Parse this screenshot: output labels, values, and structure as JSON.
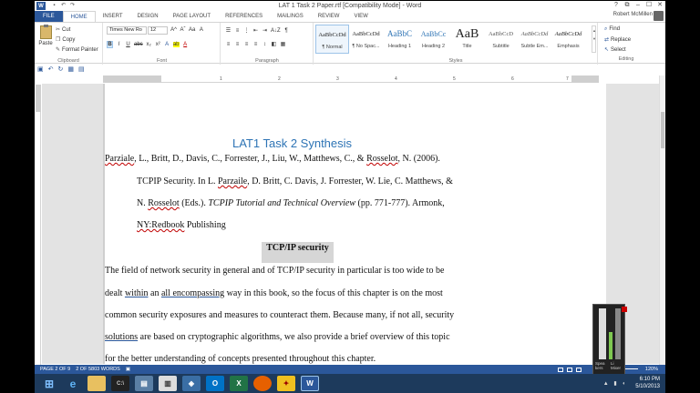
{
  "window": {
    "title": "LAT 1 Task 2 Paper.rtf [Compatibility Mode] - Word",
    "app_icon": "W",
    "controls": [
      "?",
      "⧉",
      "–",
      "☐",
      "✕"
    ]
  },
  "tabs": [
    "FILE",
    "HOME",
    "INSERT",
    "DESIGN",
    "PAGE LAYOUT",
    "REFERENCES",
    "MAILINGS",
    "REVIEW",
    "VIEW"
  ],
  "active_tab": "HOME",
  "user": {
    "name": "Robert McMillen"
  },
  "ribbon": {
    "clipboard": {
      "label": "Clipboard",
      "paste": "Paste",
      "cut": "Cut",
      "copy": "Copy",
      "format_painter": "Format Painter"
    },
    "font": {
      "label": "Font",
      "font_name": "Times New Ro",
      "font_size": "12",
      "grow": "A^",
      "shrink": "Aˇ",
      "case": "Aa",
      "clear": "A",
      "bold": "B",
      "italic": "I",
      "underline": "U",
      "strike": "abc",
      "sub": "x₂",
      "sup": "x²",
      "effects": "A",
      "highlight": "ab",
      "color": "A"
    },
    "paragraph": {
      "label": "Paragraph",
      "pilcrow": "¶",
      "sort": "A↓Z"
    },
    "styles": {
      "label": "Styles",
      "items": [
        {
          "sample": "AaBbCcDd",
          "name": "¶ Normal"
        },
        {
          "sample": "AaBbCcDd",
          "name": "¶ No Spac..."
        },
        {
          "sample": "AaBbC",
          "name": "Heading 1"
        },
        {
          "sample": "AaBbCc",
          "name": "Heading 2"
        },
        {
          "sample": "AaB",
          "name": "Title"
        },
        {
          "sample": "AaBbCcD",
          "name": "Subtitle"
        },
        {
          "sample": "AaBbCcDd",
          "name": "Subtle Em..."
        },
        {
          "sample": "AaBbCcDd",
          "name": "Emphasis"
        }
      ]
    },
    "editing": {
      "label": "Editing",
      "find": "Find",
      "replace": "Replace",
      "select": "Select"
    }
  },
  "ruler": {
    "ticks": [
      "1",
      "2",
      "3",
      "4",
      "5",
      "6",
      "7"
    ]
  },
  "document": {
    "heading": "LAT1 Task 2 Synthesis",
    "ref_line1_a": "Parziale",
    "ref_line1_b": ", L., Britt, D., Davis, C., Forrester, J., Liu, W., Matthews, C., & ",
    "ref_line1_c": "Rosselot",
    "ref_line1_d": ", N. (2006).",
    "ref_line2_a": "TCPIP Security. In L. ",
    "ref_line2_b": "Parzaile",
    "ref_line2_c": ", D. Britt, C. Davis, J. Forrester, W. Lie, C. Matthews, &",
    "ref_line3_a": "N. ",
    "ref_line3_b": "Rosselot",
    "ref_line3_c": " (Eds.). ",
    "ref_line3_d": "TCPIP Tutorial and Technical Overview",
    "ref_line3_e": " (pp. 771-777).  Armonk,",
    "ref_line4_a": "NY:Redbook",
    "ref_line4_b": " Publishing",
    "section_title": "TCP/IP security",
    "para_l1": "The field of network security in general and of TCP/IP security in particular is too wide to be",
    "para_l2_a": "dealt ",
    "para_l2_b": "within",
    "para_l2_c": " an ",
    "para_l2_d": "all encompassing",
    "para_l2_e": " way in this book, so the focus of this chapter is on the most",
    "para_l3": "common security exposures and measures to counteract them. Because many, if not all, security",
    "para_l4_a": "solutions",
    "para_l4_b": " are based on cryptographic algorithms, we also provide a brief overview of this topic",
    "para_l5": "for the better understanding of concepts presented throughout this chapter."
  },
  "status": {
    "page": "PAGE 2 OF 9",
    "words": "2 OF 5803 WORDS",
    "zoom": "120%"
  },
  "volume": {
    "label1": "Spea",
    "label2": "kers",
    "label3": "Li",
    "label4": "Mixer"
  },
  "taskbar": {
    "time": "6:10 PM",
    "date": "5/10/2013",
    "colors": {
      "word": "#2b579a",
      "excel": "#217346",
      "outlook": "#0072c6",
      "firefox": "#e66000"
    }
  }
}
